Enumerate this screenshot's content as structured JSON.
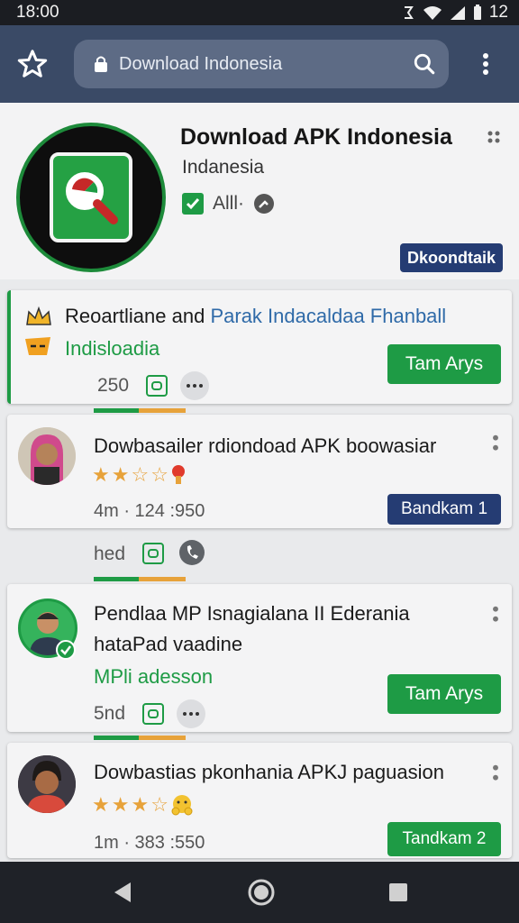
{
  "status_bar": {
    "time": "18:00",
    "battery": "12"
  },
  "search": {
    "text": "Download  Indonesia"
  },
  "app": {
    "title": "Download APK Indonesia",
    "subtitle": "Indanesia",
    "meta": "Alll·",
    "download_label": "Dkoondtaik"
  },
  "featured": {
    "line1_a": "Reoartliane and ",
    "line1_b": "Parak Indacaldaa Fhanball",
    "line2": "Indisloadia",
    "count": "250",
    "button_label": "Tam Arys"
  },
  "items": [
    {
      "title": "Dowbasailer rdiondoad APK boowasiar",
      "meta": "4m · 124 :950",
      "button_label": "Bandkam 1",
      "rating": 2
    },
    {
      "title": "Pendlaa MP  Isnagialana II Ederania",
      "title2": "hataPad vaadine",
      "subtitle": "MPli adesson",
      "count": "5nd",
      "button_label": "Tam Arys"
    },
    {
      "title": "Dowbastias pkonhania APKJ paguasion",
      "meta": "1m · 383 :550",
      "button_label": "Tandkam 2",
      "rating": 3
    }
  ],
  "between": {
    "label": "hed"
  },
  "colors": {
    "topbar": "#3a4a66",
    "green": "#1e9b45",
    "navy": "#253c73",
    "orange": "#e7a23a"
  }
}
